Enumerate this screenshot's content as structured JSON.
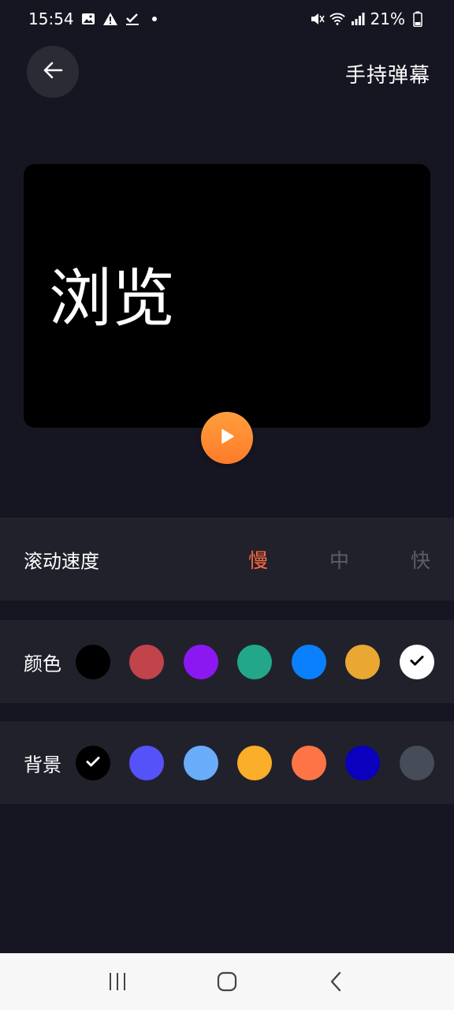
{
  "status_bar": {
    "time": "15:54",
    "battery": "21%",
    "left_icons": [
      "gallery-icon",
      "warning-icon",
      "check-icon",
      "dot-icon"
    ],
    "right_icons": [
      "mute-icon",
      "wifi-icon",
      "signal-icon",
      "battery-icon"
    ]
  },
  "header": {
    "title": "手持弹幕",
    "back_icon": "arrow-left-icon"
  },
  "preview": {
    "text": "浏览",
    "play_icon": "play-icon"
  },
  "speed": {
    "label": "滚动速度",
    "options": [
      "慢",
      "中",
      "快"
    ],
    "selected": "慢"
  },
  "text_color": {
    "label": "颜色",
    "swatches": [
      "#000000",
      "#c0444a",
      "#8b18f0",
      "#22a889",
      "#0a80ff",
      "#eaa832",
      "#ffffff"
    ],
    "selected_index": 6
  },
  "background": {
    "label": "背景",
    "swatches": [
      "#000000",
      "#5652fa",
      "#69adfa",
      "#fbae2a",
      "#ff7446",
      "#0a00bd",
      "#464c58"
    ],
    "selected_index": 0
  },
  "navbar": {
    "icons": [
      "recent-apps-icon",
      "home-icon",
      "back-nav-icon"
    ]
  },
  "colors": {
    "accent": "#ff6a3d",
    "background": "#161622",
    "panel": "#21212c"
  }
}
